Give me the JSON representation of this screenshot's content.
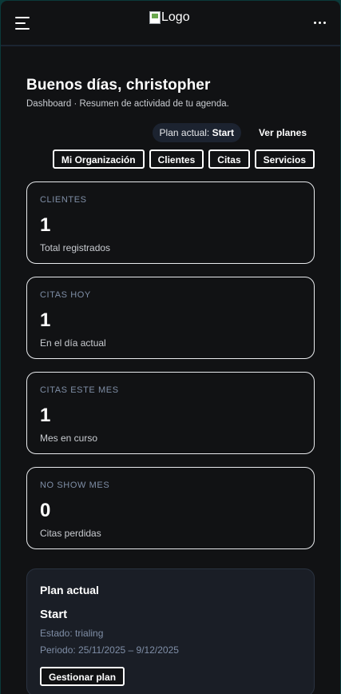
{
  "header": {
    "logo_alt": "Logo",
    "menu_icon": "hamburger-menu-icon",
    "more_icon": "more-horizontal-icon"
  },
  "greeting": "Buenos días, christopher",
  "subtitle": "Dashboard · Resumen de actividad de tu agenda.",
  "plan_status": {
    "prefix": "Plan actual:",
    "plan": "Start",
    "link": "Ver planes"
  },
  "nav_buttons": [
    "Mi Organización",
    "Clientes",
    "Citas",
    "Servicios"
  ],
  "stats": [
    {
      "label": "CLIENTES",
      "value": "1",
      "desc": "Total registrados"
    },
    {
      "label": "CITAS HOY",
      "value": "1",
      "desc": "En el día actual"
    },
    {
      "label": "CITAS ESTE MES",
      "value": "1",
      "desc": "Mes en curso"
    },
    {
      "label": "NO SHOW MES",
      "value": "0",
      "desc": "Citas perdidas"
    }
  ],
  "plan_card": {
    "title": "Plan actual",
    "name": "Start",
    "status": "Estado: trialing",
    "period": "Periodo: 25/11/2025 – 9/12/2025",
    "button": "Gestionar plan"
  },
  "colors": {
    "background": "#111214",
    "accent_border": "#e8eaed",
    "muted_label": "#7f8ea6",
    "pill_bg": "#1c2330"
  }
}
